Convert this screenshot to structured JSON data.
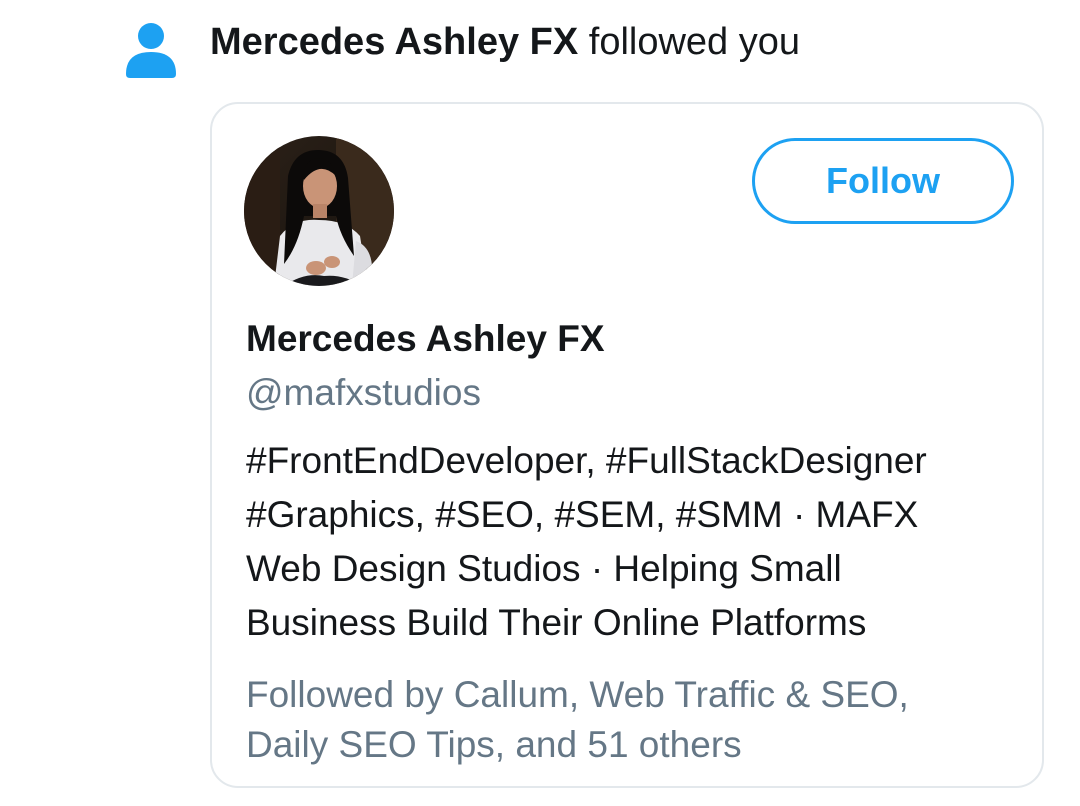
{
  "notification": {
    "icon": "person-icon",
    "actor": "Mercedes Ashley FX",
    "action": "followed you"
  },
  "card": {
    "avatar": "profile-photo",
    "follow_label": "Follow",
    "display_name": "Mercedes Ashley FX",
    "handle": "@mafxstudios",
    "bio_lines": [
      "#FrontEndDeveloper, #FullStackDesigner",
      "#Graphics, #SEO, #SEM, #SMM · MAFX",
      "Web Design Studios · Helping Small",
      "Business Build Their Online Platforms"
    ],
    "followed_by_lines": [
      "Followed by Callum, Web Traffic & SEO,",
      "Daily SEO Tips, and 51 others"
    ]
  },
  "colors": {
    "accent": "#1da1f2",
    "primary_text": "#14171a",
    "secondary_text": "#657786",
    "card_border": "#e3e8ec"
  }
}
